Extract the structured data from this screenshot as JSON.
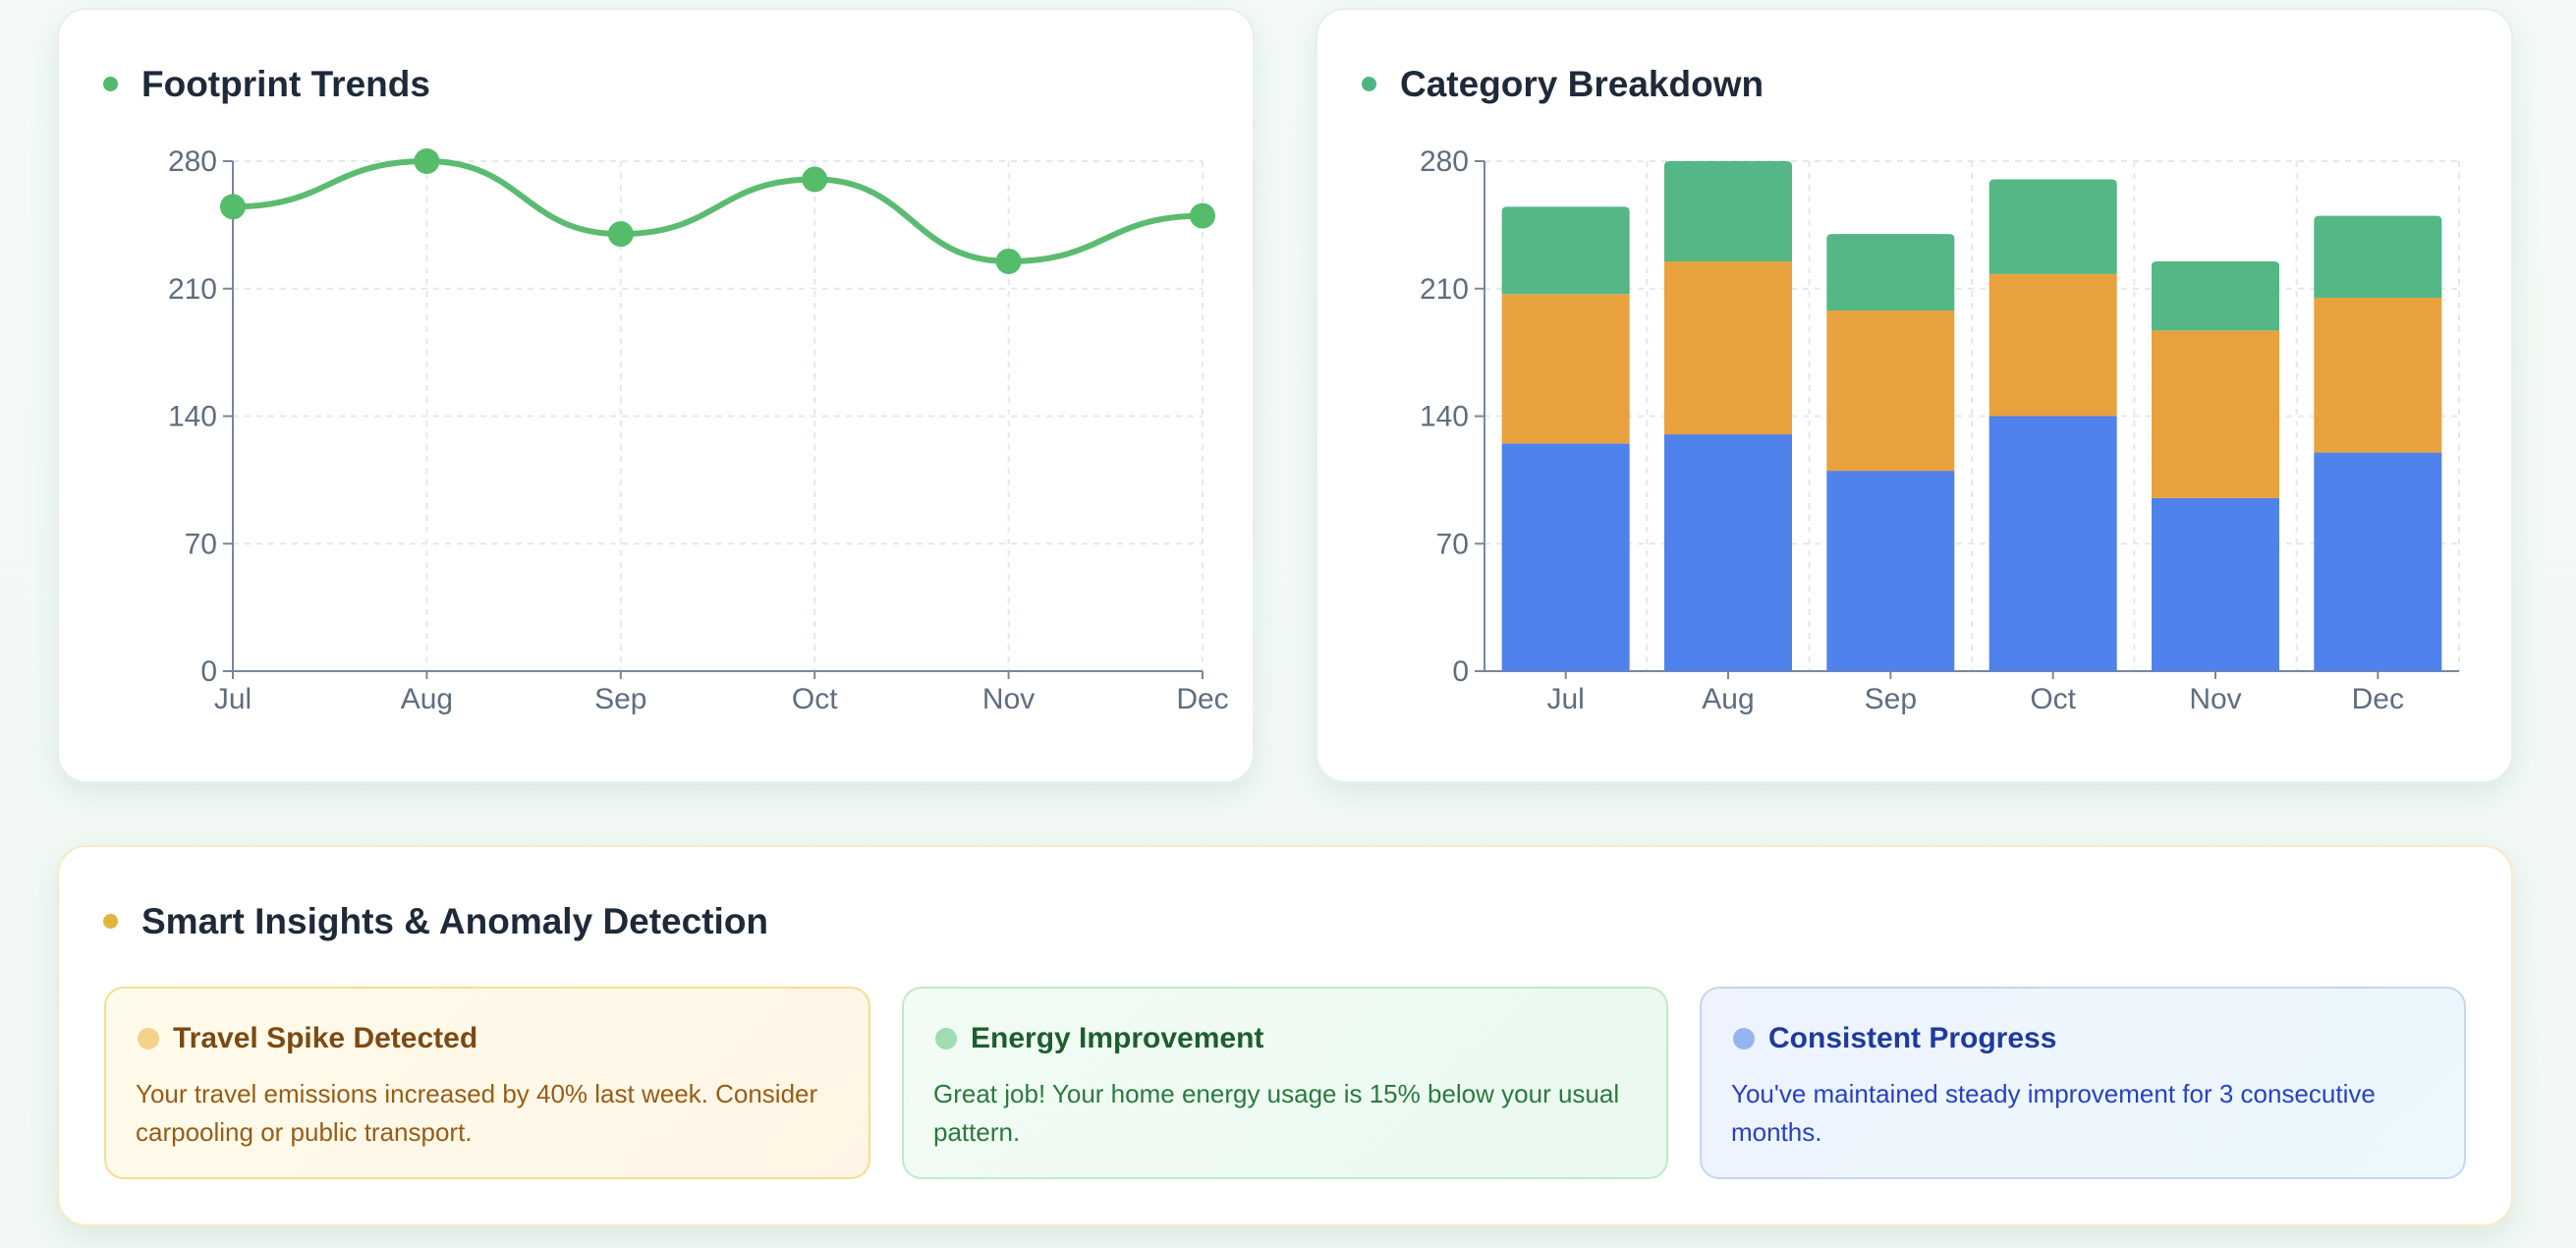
{
  "colors": {
    "trend_line": "#5bbb70",
    "trend_point": "#55bd6a",
    "blue": "#5082ec",
    "orange": "#e8a23d",
    "green": "#54b785",
    "grid": "#e4e8ee",
    "axis": "#7a8799"
  },
  "trends": {
    "title": "Footprint Trends",
    "dot_color": "#52b86a"
  },
  "breakdown": {
    "title": "Category Breakdown",
    "dot_color": "#4cb681"
  },
  "insights": {
    "title": "Smart Insights & Anomaly Detection",
    "dot_color": "#e2b43c",
    "items": [
      {
        "title": "Travel Spike Detected",
        "text": "Your travel emissions increased by 40% last week. Consider carpooling or public transport.",
        "dot_color": "#f3d389",
        "title_color": "#7c4a12",
        "text_color": "#9a5c14"
      },
      {
        "title": "Energy Improvement",
        "text": "Great job! Your home energy usage is 15% below your usual pattern.",
        "dot_color": "#9fdcaf",
        "title_color": "#1e5e2e",
        "text_color": "#2b7a3d"
      },
      {
        "title": "Consistent Progress",
        "text": "You've maintained steady improvement for 3 consecutive months.",
        "dot_color": "#97b3f1",
        "title_color": "#1f3a9e",
        "text_color": "#2741c8"
      }
    ]
  },
  "chart_data": [
    {
      "type": "line",
      "title": "Footprint Trends",
      "categories": [
        "Jul",
        "Aug",
        "Sep",
        "Oct",
        "Nov",
        "Dec"
      ],
      "series": [
        {
          "values": [
            255,
            280,
            240,
            270,
            225,
            250
          ]
        }
      ],
      "ylim": [
        0,
        280
      ],
      "yticks": [
        0,
        70,
        140,
        210,
        280
      ],
      "grid": true,
      "legend": "none",
      "curve": "smooth"
    },
    {
      "type": "bar",
      "stacked": true,
      "title": "Category Breakdown",
      "categories": [
        "Jul",
        "Aug",
        "Sep",
        "Oct",
        "Nov",
        "Dec"
      ],
      "series": [
        {
          "values": [
            125,
            130,
            110,
            140,
            95,
            120
          ]
        },
        {
          "values": [
            82,
            95,
            88,
            78,
            92,
            85
          ]
        },
        {
          "values": [
            48,
            55,
            42,
            52,
            38,
            45
          ]
        }
      ],
      "ylim": [
        0,
        280
      ],
      "yticks": [
        0,
        70,
        140,
        210,
        280
      ],
      "grid": true,
      "legend": "none"
    }
  ]
}
